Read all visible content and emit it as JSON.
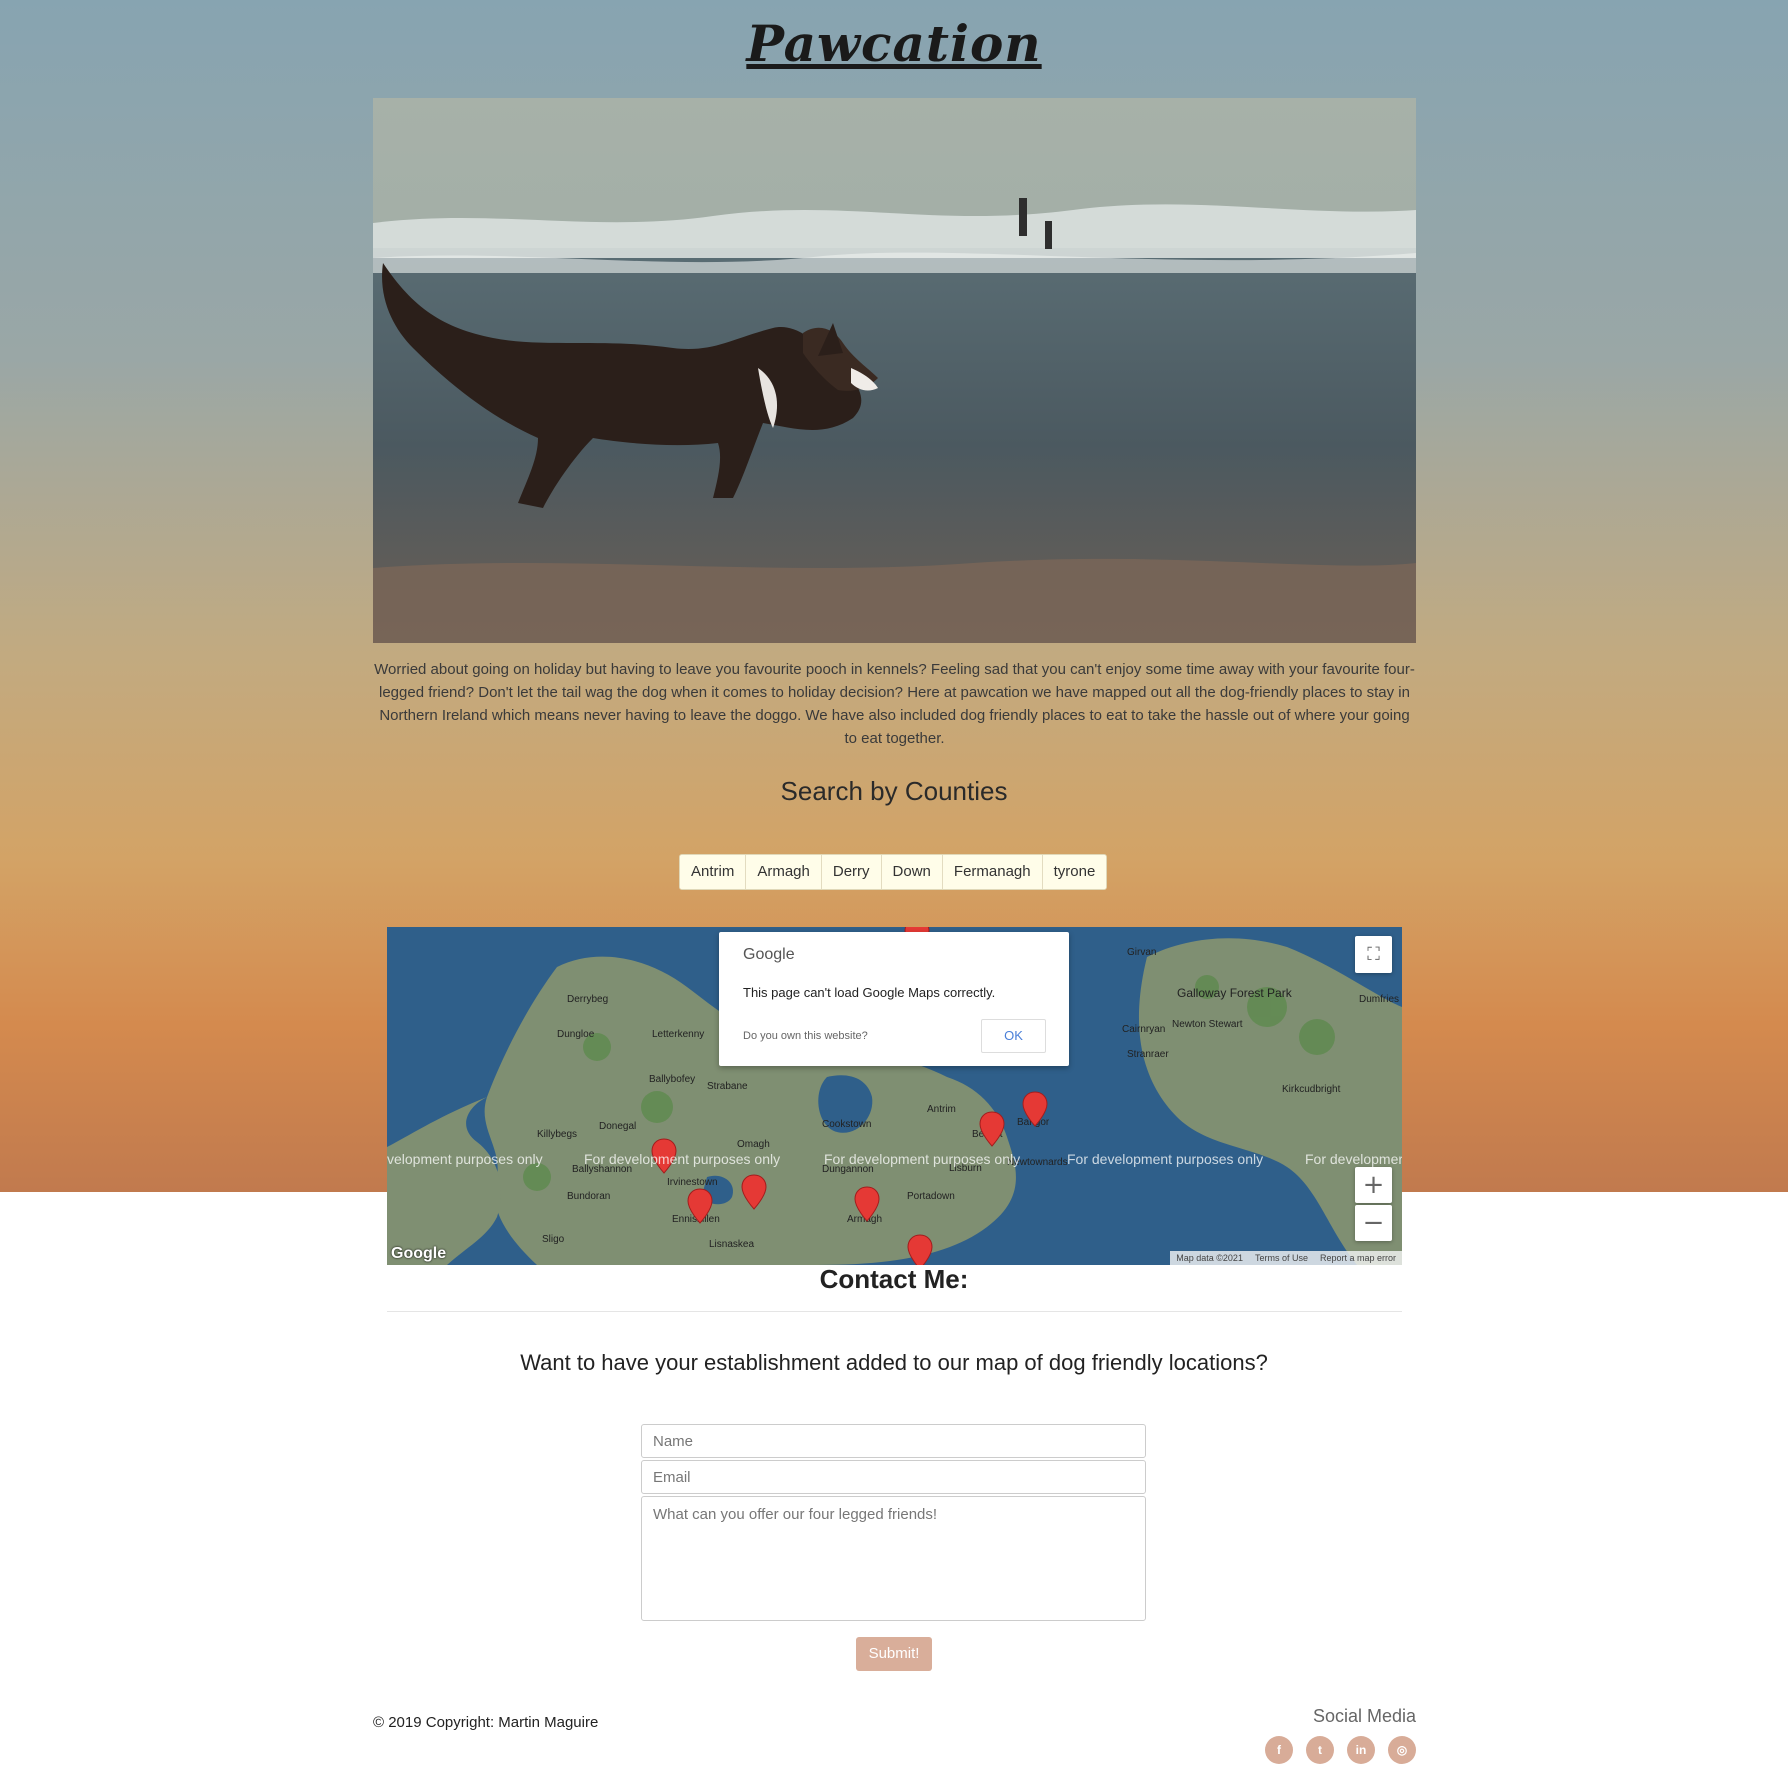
{
  "header": {
    "title": "Pawcation"
  },
  "hero_image": {
    "description_icon": "dog-on-beach-photo"
  },
  "intro": {
    "text": "Worried about going on holiday but having to leave you favourite pooch in kennels? Feeling sad that you can't enjoy some time away with your favourite four-legged friend? Don't let the tail wag the dog when it comes to holiday decision? Here at pawcation we have mapped out all the dog-friendly places to stay in Northern Ireland which means never having to leave the doggo. We have also included dog friendly places to eat to take the hassle out of where your going to eat together."
  },
  "search": {
    "heading": "Search by Counties",
    "counties": [
      "Antrim",
      "Armagh",
      "Derry",
      "Down",
      "Fermanagh",
      "tyrone"
    ]
  },
  "map": {
    "dialog": {
      "brand": "Google",
      "message": "This page can't load Google Maps correctly.",
      "question": "Do you own this website?",
      "ok_label": "OK"
    },
    "watermark": "For development purposes only",
    "watermark_left_partial": "velopment purposes only",
    "watermark_right_partial": "For developmer",
    "logo": "Google",
    "footer": {
      "data": "Map data ©2021",
      "terms": "Terms of Use",
      "report": "Report a map error"
    },
    "controls": {
      "fullscreen_icon": "fullscreen-icon",
      "zoom_in": "+",
      "zoom_out": "−"
    },
    "place_labels": [
      "Derrybeg",
      "Dungloe",
      "Letterkenny",
      "Ballybofey",
      "Strabane",
      "Donegal",
      "Killybegs",
      "Omagh",
      "Ballyshannon",
      "Cookstown",
      "Antrim",
      "Belfast",
      "Bangor",
      "Dungannon",
      "Lisburn",
      "Newtownards",
      "Bundoran",
      "Irvinestown",
      "Enniskillen",
      "Portadown",
      "Armagh",
      "Lisnaskea",
      "Sligo",
      "Girvan",
      "Galloway Forest Park",
      "Newton Stewart",
      "Cairnryan",
      "Stranraer",
      "Kirkcudbright",
      "Dumfries"
    ],
    "colors": {
      "water": "#2f5f8a",
      "land": "#8a9a7a",
      "marker": "#e53935"
    }
  },
  "contact": {
    "heading": "Contact Me:",
    "subheading": "Want to have your establishment added to our map of dog friendly locations?",
    "name_placeholder": "Name",
    "email_placeholder": "Email",
    "message_placeholder": "What can you offer our four legged friends!",
    "submit_label": "Submit!"
  },
  "footer": {
    "copyright": "© 2019 Copyright: Martin Maguire",
    "social_title": "Social Media",
    "social_icons": [
      {
        "icon": "facebook-icon",
        "glyph": "f"
      },
      {
        "icon": "twitter-icon",
        "glyph": "t"
      },
      {
        "icon": "linkedin-icon",
        "glyph": "in"
      },
      {
        "icon": "instagram-icon",
        "glyph": "◎"
      }
    ],
    "accent_color": "#d8ac98"
  }
}
